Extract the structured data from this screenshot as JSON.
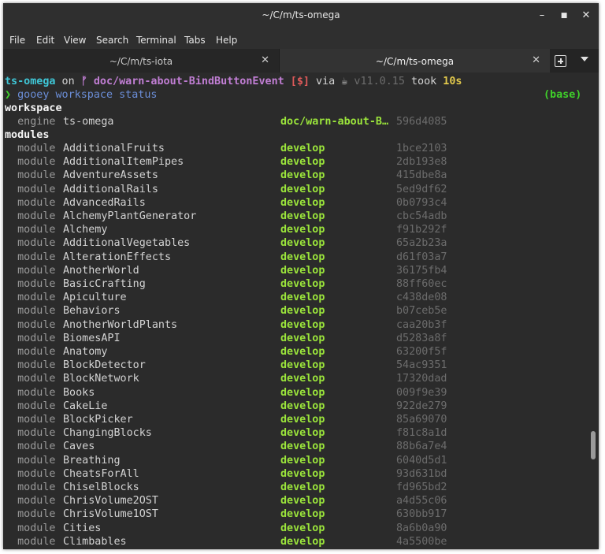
{
  "window": {
    "title": "~/C/m/ts-omega"
  },
  "window_controls": {
    "minimize": "–",
    "maximize": "■",
    "close": "✕"
  },
  "menubar": {
    "items": [
      "File",
      "Edit",
      "View",
      "Search",
      "Terminal",
      "Tabs",
      "Help"
    ]
  },
  "tabs": [
    {
      "label": "~/C/m/ts-iota",
      "active": false,
      "close": "✕"
    },
    {
      "label": "~/C/m/ts-omega",
      "active": true,
      "close": "✕"
    }
  ],
  "prompt": {
    "dir": "ts-omega",
    "on": " on ",
    "branch_icon": "ᚠ",
    "branch": " doc/warn-about-BindButtonEvent ",
    "status": "[$]",
    "via": " via ",
    "runtime_icon": "☕",
    "runtime": " v11.0.15",
    "took": " took ",
    "duration": "10s",
    "arrow": "❯",
    "command": "gooey",
    "args": " workspace status",
    "env": "(base)"
  },
  "workspace": {
    "header": "workspace",
    "engine_label": "  engine",
    "engine_name": "ts-omega",
    "engine_branch": "doc/warn-about-B…",
    "engine_hash": "596d4085"
  },
  "modules": {
    "header": "modules",
    "row_label": "  module",
    "items": [
      {
        "name": "AdditionalFruits",
        "branch": "develop",
        "hash": "1bce2103"
      },
      {
        "name": "AdditionalItemPipes",
        "branch": "develop",
        "hash": "2db193e8"
      },
      {
        "name": "AdventureAssets",
        "branch": "develop",
        "hash": "415dbe8a"
      },
      {
        "name": "AdditionalRails",
        "branch": "develop",
        "hash": "5ed9df62"
      },
      {
        "name": "AdvancedRails",
        "branch": "develop",
        "hash": "0b0793c4"
      },
      {
        "name": "AlchemyPlantGenerator",
        "branch": "develop",
        "hash": "cbc54adb"
      },
      {
        "name": "Alchemy",
        "branch": "develop",
        "hash": "f91b292f"
      },
      {
        "name": "AdditionalVegetables",
        "branch": "develop",
        "hash": "65a2b23a"
      },
      {
        "name": "AlterationEffects",
        "branch": "develop",
        "hash": "d61f03a7"
      },
      {
        "name": "AnotherWorld",
        "branch": "develop",
        "hash": "36175fb4"
      },
      {
        "name": "BasicCrafting",
        "branch": "develop",
        "hash": "88ff60ec"
      },
      {
        "name": "Apiculture",
        "branch": "develop",
        "hash": "c438de08"
      },
      {
        "name": "Behaviors",
        "branch": "develop",
        "hash": "b07ceb5e"
      },
      {
        "name": "AnotherWorldPlants",
        "branch": "develop",
        "hash": "caa20b3f"
      },
      {
        "name": "BiomesAPI",
        "branch": "develop",
        "hash": "d5283a8f"
      },
      {
        "name": "Anatomy",
        "branch": "develop",
        "hash": "63200f5f"
      },
      {
        "name": "BlockDetector",
        "branch": "develop",
        "hash": "54ac9351"
      },
      {
        "name": "BlockNetwork",
        "branch": "develop",
        "hash": "17320dad"
      },
      {
        "name": "Books",
        "branch": "develop",
        "hash": "009f9e39"
      },
      {
        "name": "CakeLie",
        "branch": "develop",
        "hash": "922de279"
      },
      {
        "name": "BlockPicker",
        "branch": "develop",
        "hash": "85a69070"
      },
      {
        "name": "ChangingBlocks",
        "branch": "develop",
        "hash": "f81c8a1d"
      },
      {
        "name": "Caves",
        "branch": "develop",
        "hash": "88b6a7e4"
      },
      {
        "name": "Breathing",
        "branch": "develop",
        "hash": "6040d5d1"
      },
      {
        "name": "CheatsForAll",
        "branch": "develop",
        "hash": "93d631bd"
      },
      {
        "name": "ChiselBlocks",
        "branch": "develop",
        "hash": "fd965bd2"
      },
      {
        "name": "ChrisVolume2OST",
        "branch": "develop",
        "hash": "a4d55c06"
      },
      {
        "name": "ChrisVolume1OST",
        "branch": "develop",
        "hash": "630bb917"
      },
      {
        "name": "Cities",
        "branch": "develop",
        "hash": "8a6b0a90"
      },
      {
        "name": "Climbables",
        "branch": "develop",
        "hash": "4a5500be"
      }
    ]
  },
  "colors": {
    "terminal_bg": "#2b2b2b",
    "prompt_dir": "#3fc6d6",
    "git_branch": "#c17ed4",
    "git_status": "#e05a5a",
    "duration": "#e2c94c",
    "prompt_arrow": "#3fd02a",
    "command": "#6b8ed8",
    "module_branch": "#9be53b",
    "hash": "#6c6c6c"
  }
}
